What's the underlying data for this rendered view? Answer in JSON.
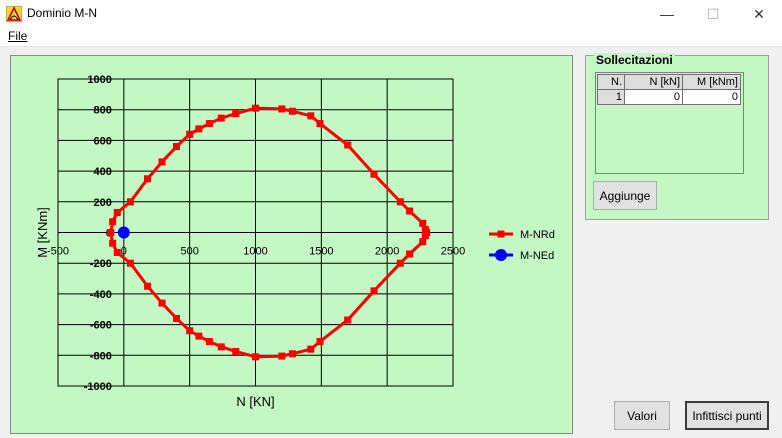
{
  "window": {
    "title": "Dominio M-N",
    "minimize_glyph": "—",
    "maximize_glyph": "☐",
    "close_glyph": "✕"
  },
  "menu": {
    "file_label": "File"
  },
  "chart_data": {
    "type": "line",
    "xlabel": "N [KN]",
    "ylabel": "M [KNm]",
    "xlim": [
      -500,
      2500
    ],
    "ylim": [
      -1000,
      1000
    ],
    "x_ticks": [
      -500,
      0,
      500,
      1000,
      1500,
      2000,
      2500
    ],
    "y_ticks": [
      -1000,
      -800,
      -600,
      -400,
      -200,
      0,
      200,
      400,
      600,
      800,
      1000
    ],
    "x_tick_labels": [
      "-500",
      "0",
      "500",
      "1000",
      "1500",
      "2000",
      "2500"
    ],
    "y_tick_labels": [
      "-1000",
      "-800",
      "-600",
      "-400",
      "-200",
      "0",
      "200",
      "400",
      "600",
      "800",
      "1000"
    ],
    "grid": true,
    "legend_position": "right",
    "series": [
      {
        "name": "M-NRd",
        "color": "#ff0000",
        "marker": "square",
        "points": [
          [
            -100,
            0
          ],
          [
            -85,
            70
          ],
          [
            -50,
            130
          ],
          [
            50,
            200
          ],
          [
            180,
            350
          ],
          [
            290,
            460
          ],
          [
            400,
            560
          ],
          [
            500,
            640
          ],
          [
            570,
            675
          ],
          [
            650,
            710
          ],
          [
            740,
            745
          ],
          [
            850,
            775
          ],
          [
            1000,
            810
          ],
          [
            1200,
            805
          ],
          [
            1280,
            790
          ],
          [
            1420,
            760
          ],
          [
            1490,
            710
          ],
          [
            1700,
            570
          ],
          [
            1900,
            380
          ],
          [
            2100,
            200
          ],
          [
            2170,
            140
          ],
          [
            2270,
            60
          ],
          [
            2290,
            20
          ],
          [
            2300,
            0
          ],
          [
            2290,
            -20
          ],
          [
            2270,
            -60
          ],
          [
            2170,
            -140
          ],
          [
            2100,
            -200
          ],
          [
            1900,
            -380
          ],
          [
            1700,
            -570
          ],
          [
            1490,
            -710
          ],
          [
            1420,
            -760
          ],
          [
            1280,
            -790
          ],
          [
            1200,
            -805
          ],
          [
            1000,
            -810
          ],
          [
            850,
            -775
          ],
          [
            740,
            -745
          ],
          [
            650,
            -710
          ],
          [
            570,
            -675
          ],
          [
            500,
            -640
          ],
          [
            400,
            -560
          ],
          [
            290,
            -460
          ],
          [
            180,
            -350
          ],
          [
            50,
            -200
          ],
          [
            -50,
            -130
          ],
          [
            -85,
            -70
          ],
          [
            -100,
            0
          ]
        ]
      },
      {
        "name": "M-NEd",
        "color": "#0000ff",
        "marker": "circle",
        "points": [
          [
            0,
            0
          ]
        ]
      }
    ]
  },
  "sollecitazioni": {
    "title": "Sollecitazioni",
    "columns": [
      "N.",
      "N [kN]",
      "M [kNm]"
    ],
    "rows": [
      [
        "1",
        "0",
        "0"
      ]
    ],
    "add_label": "Aggiunge"
  },
  "buttons": {
    "valori_label": "Valori",
    "infittisci_label": "Infittisci punti"
  }
}
